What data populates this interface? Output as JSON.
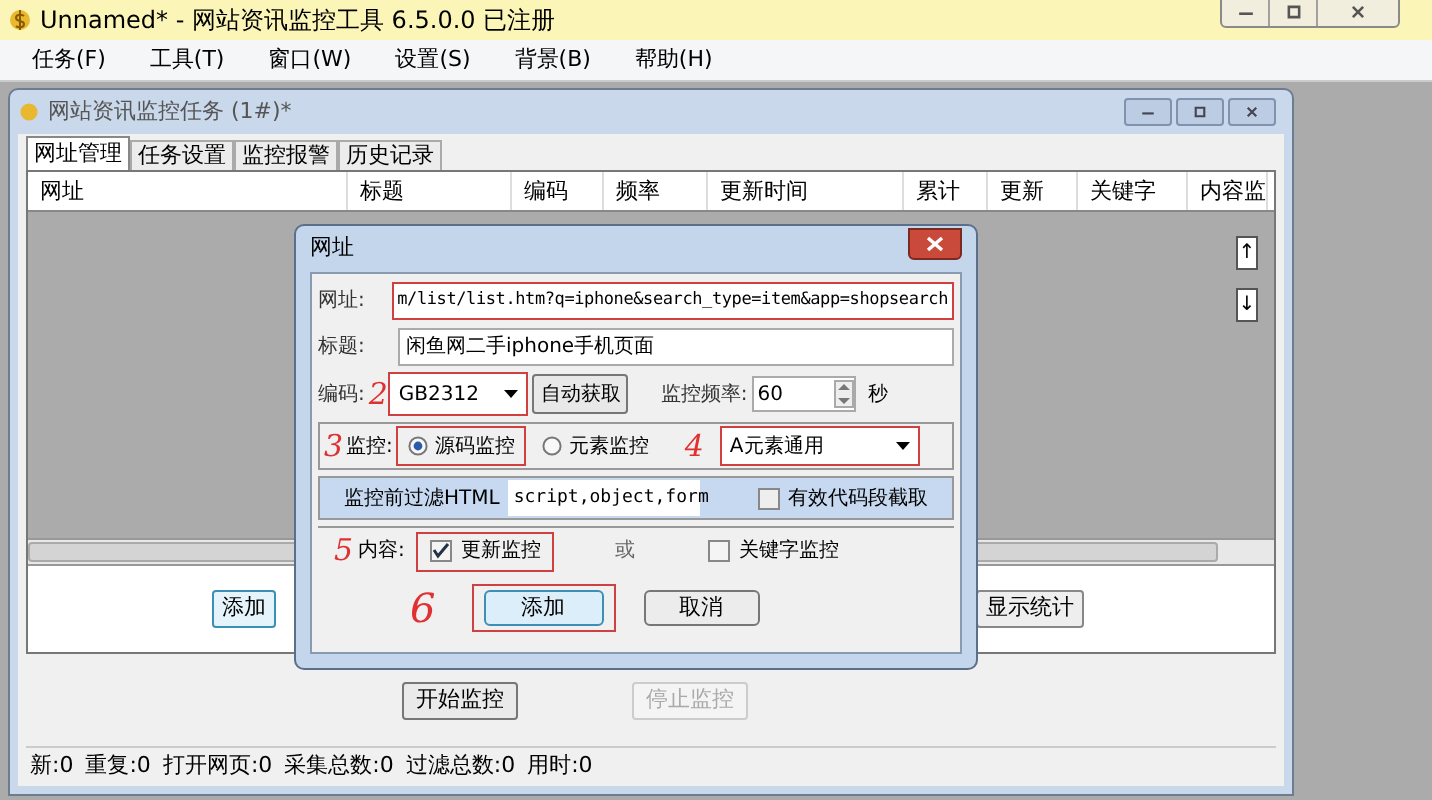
{
  "app": {
    "title": "Unnamed* - 网站资讯监控工具 6.5.0.0  已注册"
  },
  "menu": [
    "任务(F)",
    "工具(T)",
    "窗口(W)",
    "设置(S)",
    "背景(B)",
    "帮助(H)"
  ],
  "child_window": {
    "title": "网站资讯监控任务  (1#)*"
  },
  "tabs": [
    {
      "label": "网址管理",
      "selected": true
    },
    {
      "label": "任务设置",
      "selected": false
    },
    {
      "label": "监控报警",
      "selected": false
    },
    {
      "label": "历史记录",
      "selected": false
    }
  ],
  "table": {
    "columns": [
      "网址",
      "标题",
      "编码",
      "频率",
      "更新时间",
      "累计",
      "更新",
      "关键字",
      "内容监"
    ]
  },
  "scroll_buttons": [
    "↑",
    "↓"
  ],
  "panel_buttons": [
    {
      "label": "添加",
      "focused": true
    },
    {
      "label": "显示统计",
      "focused": false
    }
  ],
  "control_buttons": [
    {
      "label": "开始监控",
      "disabled": false
    },
    {
      "label": "停止监控",
      "disabled": true
    }
  ],
  "status_bar": [
    "新:0",
    "重复:0",
    "打开网页:0",
    "采集总数:0",
    "过滤总数:0",
    "用时:0"
  ],
  "dialog": {
    "title": "网址",
    "url": {
      "label": "网址:",
      "value": "m/list/list.htm?q=iphone&search_type=item&app=shopsearch"
    },
    "page_title": {
      "label": "标题:",
      "value": "闲鱼网二手iphone手机页面"
    },
    "encoding": {
      "label": "编码:",
      "value": "GB2312",
      "mark": "2"
    },
    "auto_button": "自动获取",
    "frequency": {
      "label": "监控频率:",
      "value": "60",
      "unit": "秒"
    },
    "monitor": {
      "label": "监控:",
      "mark": "3",
      "options": [
        {
          "label": "源码监控",
          "selected": true
        },
        {
          "label": "元素监控",
          "selected": false
        }
      ],
      "mode_mark": "4",
      "mode": "A元素通用"
    },
    "filter": {
      "label": "监控前过滤HTML",
      "value": "script,object,form",
      "option": {
        "label": "有效代码段截取",
        "checked": false
      }
    },
    "content": {
      "label": "内容:",
      "mark": "5",
      "options": [
        {
          "label": "更新监控",
          "checked": true
        },
        {
          "label": "关键字监控",
          "checked": false
        }
      ],
      "separator": "或"
    },
    "buttons_mark": "6",
    "buttons": [
      "添加",
      "取消"
    ]
  }
}
